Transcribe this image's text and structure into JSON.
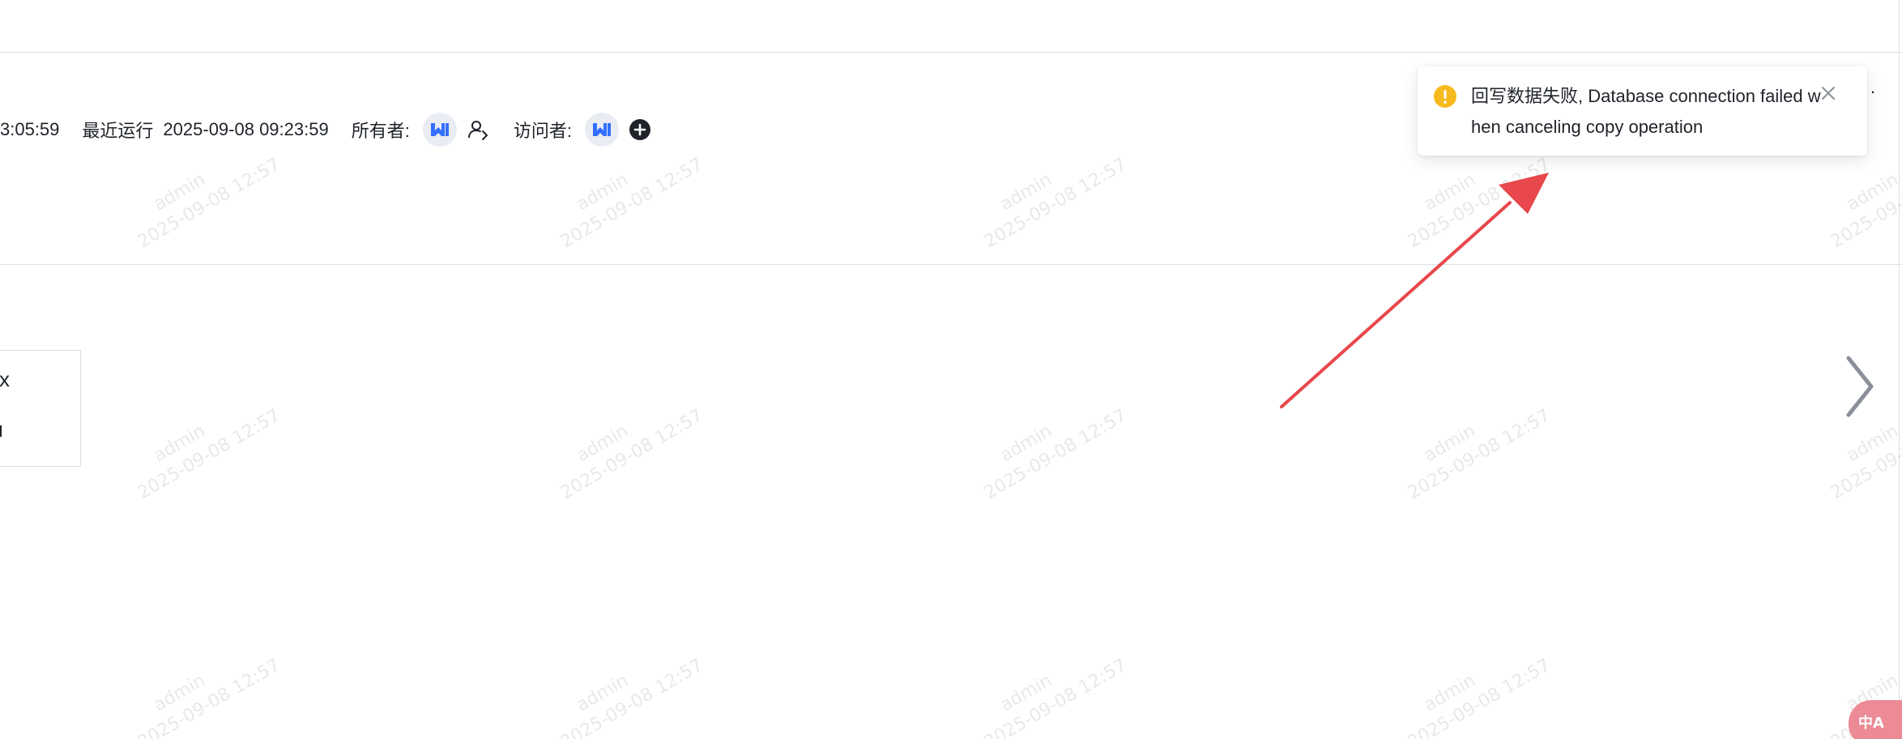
{
  "watermark": {
    "user": "admin",
    "time": "2025-09-08 12:57"
  },
  "meta": {
    "created_time_partial": "3:05:59",
    "last_run_label": "最近运行",
    "last_run_value": "2025-09-08 09:23:59",
    "owner_label": "所有者:",
    "visitor_label": "访问者:"
  },
  "more_menu": "··",
  "left_card": {
    "partial_text": "x"
  },
  "toast": {
    "type": "warning",
    "message": "回写数据失败, Database connection failed when canceling copy operation"
  },
  "icons": {
    "avatar": "workspace-logo-icon",
    "transfer": "transfer-owner-icon",
    "add": "add-circle-icon",
    "warn": "warning-icon",
    "close": "close-icon",
    "next": "chevron-right-icon",
    "translate": "translate-icon"
  },
  "translate_fab": {
    "label": "中A"
  },
  "colors": {
    "warning": "#f7ba1e",
    "annotation_arrow": "#e8474c",
    "avatar_brand": "#3370ff",
    "translate_fab": "#ec8a96"
  }
}
